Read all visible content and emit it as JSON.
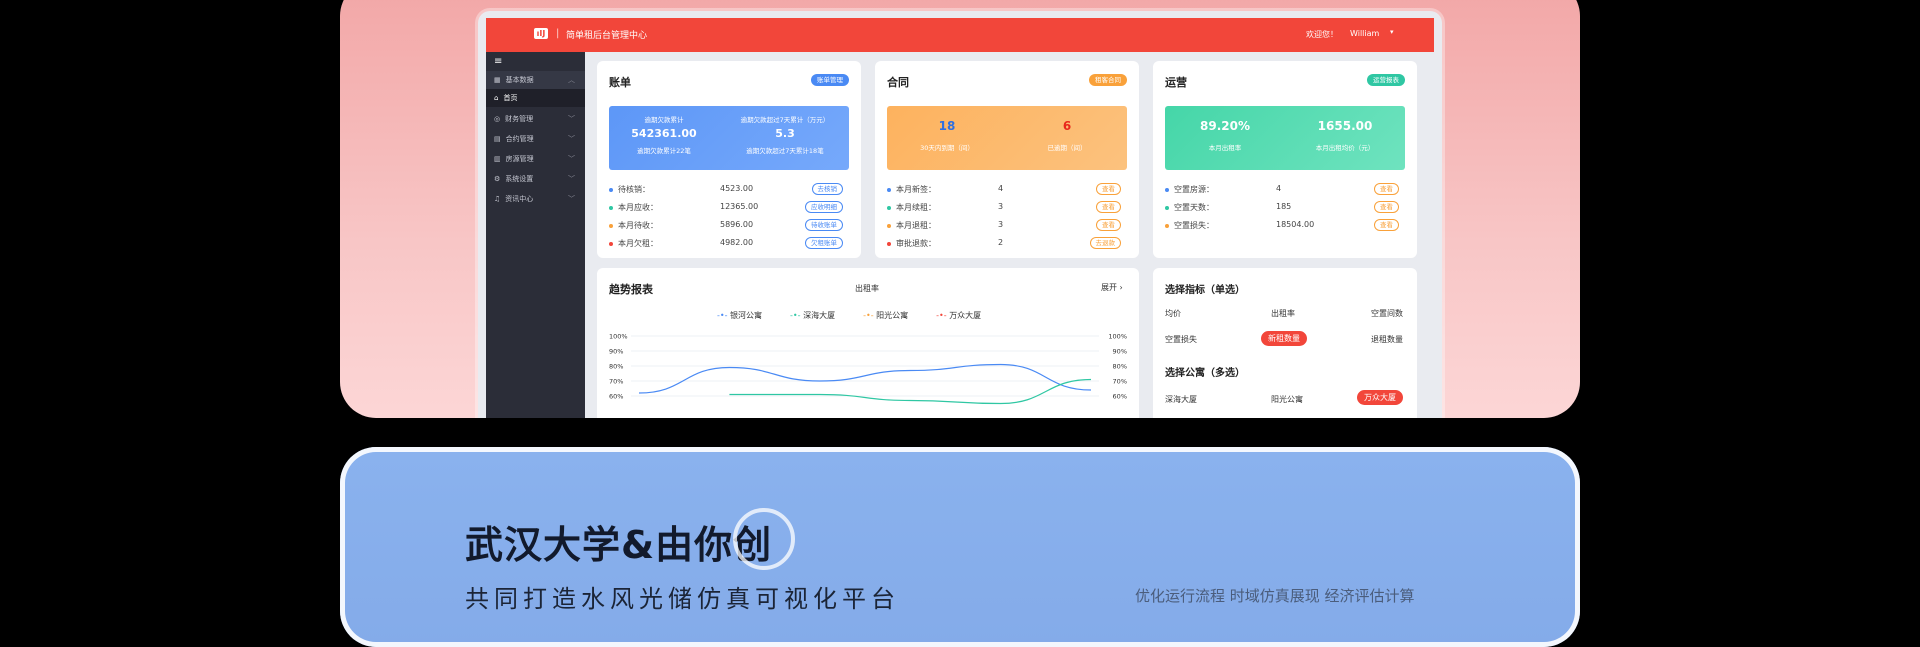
{
  "app": {
    "title": "简单租后台管理中心",
    "welcome": "欢迎您！",
    "user": "William"
  },
  "sidebar": {
    "menu_icon": "hamburger-icon",
    "items": [
      {
        "label": "基本数据"
      },
      {
        "label": "首页"
      },
      {
        "label": "财务管理"
      },
      {
        "label": "合约管理"
      },
      {
        "label": "房源管理"
      },
      {
        "label": "系统设置"
      },
      {
        "label": "资讯中心"
      }
    ]
  },
  "bill": {
    "title": "账单",
    "badge": "账单管理",
    "banner": {
      "left_label": "逾期欠款累计",
      "left_value": "542361.00",
      "left_sub": "逾期欠款累计22笔",
      "right_label": "逾期欠款超过7天累计（万元）",
      "right_value": "5.3",
      "right_sub": "逾期欠款超过7天累计18笔"
    },
    "rows": [
      {
        "label": "待核销：",
        "value": "4523.00",
        "action": "去核销",
        "color": "#4a8af4"
      },
      {
        "label": "本月应收：",
        "value": "12365.00",
        "action": "应收明细",
        "color": "#2fc7a3"
      },
      {
        "label": "本月待收：",
        "value": "5896.00",
        "action": "待收账单",
        "color": "#f9a13a"
      },
      {
        "label": "本月欠租：",
        "value": "4982.00",
        "action": "欠租账单",
        "color": "#f2463a"
      }
    ]
  },
  "contract": {
    "title": "合同",
    "badge": "租客合同",
    "banner": {
      "left_value": "18",
      "left_label": "30天内到期（间）",
      "right_value": "6",
      "right_label": "已逾期（间）"
    },
    "rows": [
      {
        "label": "本月新签：",
        "value": "4",
        "action": "查看",
        "color": "#4a8af4"
      },
      {
        "label": "本月续租：",
        "value": "3",
        "action": "查看",
        "color": "#2fc7a3"
      },
      {
        "label": "本月退租：",
        "value": "3",
        "action": "查看",
        "color": "#f9a13a"
      },
      {
        "label": "审批退款：",
        "value": "2",
        "action": "去退款",
        "color": "#f2463a"
      }
    ]
  },
  "ops": {
    "title": "运营",
    "badge": "运营报表",
    "banner": {
      "left_value": "89.20%",
      "left_label": "本月出租率",
      "right_value": "1655.00",
      "right_label": "本月出租均价（元）"
    },
    "rows": [
      {
        "label": "空置房源：",
        "value": "4",
        "action": "查看",
        "color": "#4a8af4"
      },
      {
        "label": "空置天数：",
        "value": "185",
        "action": "查看",
        "color": "#2fc7a3"
      },
      {
        "label": "空置损失：",
        "value": "18504.00",
        "action": "查看",
        "color": "#f9a13a"
      }
    ]
  },
  "trend": {
    "title": "趋势报表",
    "subtitle": "出租率",
    "expand": "展开",
    "legend": [
      {
        "name": "银河公寓",
        "color": "#4a8af4"
      },
      {
        "name": "深海大厦",
        "color": "#2fc7a3"
      },
      {
        "name": "阳光公寓",
        "color": "#f9a13a"
      },
      {
        "name": "万众大厦",
        "color": "#f2463a"
      }
    ],
    "y_ticks": [
      "100%",
      "90%",
      "80%",
      "70%",
      "60%"
    ]
  },
  "chart_data": {
    "type": "line",
    "title": "出租率",
    "ylim": [
      60,
      100
    ],
    "y_ticks": [
      "100%",
      "90%",
      "80%",
      "70%",
      "60%"
    ],
    "series": [
      {
        "name": "银河公寓",
        "color": "#4a8af4",
        "values": [
          62,
          79,
          70,
          77,
          81,
          64
        ]
      },
      {
        "name": "深海大厦",
        "color": "#2fc7a3",
        "values": [
          null,
          61,
          61,
          57,
          55,
          71
        ]
      }
    ]
  },
  "selector": {
    "single_title": "选择指标（单选）",
    "metrics": [
      "均价",
      "出租率",
      "空置间数",
      "空置损失",
      "新租数量",
      "退租数量"
    ],
    "active_metric": "新租数量",
    "multi_title": "选择公寓（多选）",
    "apartments": [
      "深海大厦",
      "阳光公寓",
      "万众大厦"
    ]
  },
  "promo": {
    "headline": "武汉大学&由你创",
    "subline": "共同打造水风光储仿真可视化平台",
    "tagline": "优化运行流程 时域仿真展现 经济评估计算"
  }
}
